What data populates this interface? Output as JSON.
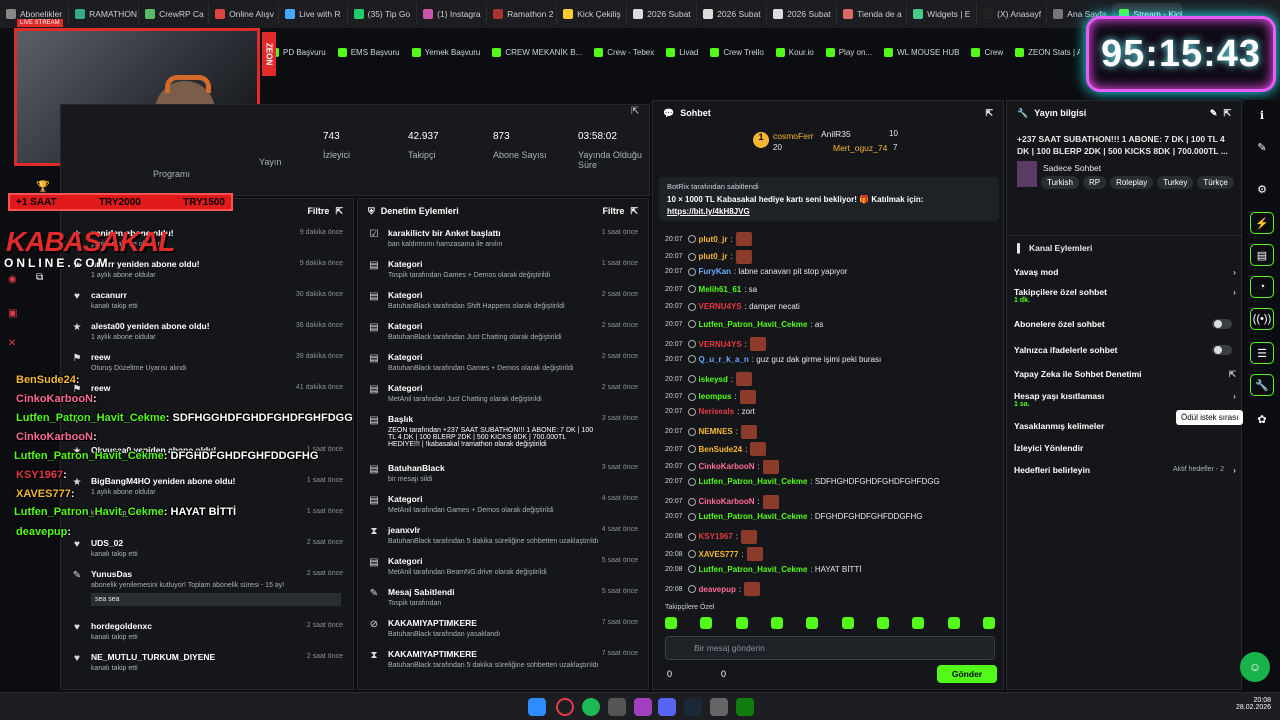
{
  "tabs": [
    "Abonelikler",
    "RAMATHON",
    "CrewRP Ca",
    "Online Alışv",
    "Live with R",
    "(35) Tip Go",
    "(1) Instagra",
    "Ramathon 2",
    "Kick Çekiliş",
    "2026 Subat",
    "2026 Subat",
    "2026 Subat",
    "Tienda de a",
    "Widgets | E",
    "(X) Anasayf",
    "Ana Sayfa",
    "Stream - Kick Dashb"
  ],
  "bookmarks": [
    "PD Başvuru",
    "EMS Başvuru",
    "Yemek Başvuru",
    "CREW MEKANİK B...",
    "Crew - Tebex",
    "Livad",
    "Crew Trello",
    "Kour.io",
    "Play on...",
    "WL MOUSE HUB",
    "Crew",
    "ZEON Stats | Aero...",
    "APIq"
  ],
  "timer": "95:15:43",
  "cam": {
    "zeon_label": "ZEON",
    "live_badge": "LIVE STREAM"
  },
  "overlay": {
    "plus_saat": "+1 SAAT",
    "try2000": "TRY2000",
    "try1500": "TRY1500",
    "brand": "KABASAKAL",
    "brand_sub": "ONLINE.COM"
  },
  "stats": {
    "left_label1": "Yayın",
    "left_label2": "Programı",
    "items": [
      {
        "value": "743",
        "label": "İzleyici"
      },
      {
        "value": "42.937",
        "label": "Takipçi"
      },
      {
        "value": "873",
        "label": "Abone Sayısı"
      },
      {
        "value": "03:58:02",
        "label": "Yayında Olduğu Süre"
      }
    ]
  },
  "events": {
    "filter": "Filtre",
    "items": [
      {
        "title": "yeniden abone oldu!",
        "sub": "yeniden abone oldular",
        "time": "9 dakika önce"
      },
      {
        "title": "nrrnrr yeniden abone oldu!",
        "sub": "1 aylık abone oldular",
        "time": "9 dakika önce"
      },
      {
        "title": "cacanurr",
        "sub": "kanalı takip etti",
        "time": "30 dakika önce"
      },
      {
        "title": "alesta00 yeniden abone oldu!",
        "sub": "1 aylık abone oldular",
        "time": "36 dakika önce"
      },
      {
        "title": "reew",
        "sub": "Oturuş Düzeltme Uyarısı alındı",
        "time": "39 dakika önce"
      },
      {
        "title": "reew",
        "sub": "",
        "time": "41 dakika önce"
      },
      {
        "title": "",
        "sub": "",
        "time": "1 saat önce"
      },
      {
        "title": "Okyusea0 yeniden abone oldu!",
        "sub": "",
        "time": "1 saat önce"
      },
      {
        "title": "BigBangM4HO yeniden abone oldu!",
        "sub": "1 aylık abone oldular",
        "time": "1 saat önce"
      },
      {
        "title": "",
        "sub": "kanalı takip etti",
        "time": "1 saat önce"
      },
      {
        "title": "UDS_02",
        "sub": "kanalı takip etti",
        "time": "2 saat önce"
      },
      {
        "title": "YunusDas",
        "sub": "abonelik yenilemesini kutluyor! Toplam abonelik süresi - 15 ay!",
        "time": "2 saat önce"
      },
      {
        "title": "hordegoldenxc",
        "sub": "kanalı takip etti",
        "time": "2 saat önce"
      },
      {
        "title": "NE_MUTLU_TURKUM_DIYENE",
        "sub": "kanalı takip etti",
        "time": "2 saat önce"
      }
    ],
    "quote": "sea sea"
  },
  "mod": {
    "title": "Denetim Eylemleri",
    "filter": "Filtre",
    "items": [
      {
        "title": "karakilictv bir Anket başlattı",
        "sub": "ban kaldırmımı hamzasama ile anılın",
        "time": "1 saat önce"
      },
      {
        "title": "Kategori",
        "sub": "Tospik tarafından Games + Demos olarak değiştirildi",
        "time": "1 saat önce"
      },
      {
        "title": "Kategori",
        "sub": "BatuhanBlack tarafından Shift Happens olarak değiştirildi",
        "time": "2 saat önce"
      },
      {
        "title": "Kategori",
        "sub": "BatuhanBlack tarafından Just Chatting olarak değiştirildi",
        "time": "2 saat önce"
      },
      {
        "title": "Kategori",
        "sub": "BatuhanBlack tarafından Games + Demos olarak değiştirildi",
        "time": "2 saat önce"
      },
      {
        "title": "Kategori",
        "sub": "MetAnil tarafından Just Chatting olarak değiştirildi",
        "time": "2 saat önce"
      },
      {
        "title": "Başlık",
        "sub": "ZEON tarafından +237 SAAT SUBATHON!!! 1 ABONE: 7 DK | 100 TL 4 DK | 100 BLERP 2DK | 500 KICKS 8DK | 700.000TL HEDİYE!!! | !kabasakal !ramathon olarak değiştirildi",
        "time": "3 saat önce"
      },
      {
        "title": "BatuhanBlack",
        "sub": "bir mesajı sildi",
        "time": "3 saat önce"
      },
      {
        "title": "Kategori",
        "sub": "MetAnil tarafından Games + Demos olarak değiştirildi",
        "time": "4 saat önce"
      },
      {
        "title": "jeanxvlr",
        "sub": "BatuhanBlack tarafından 5 dakika süreliğine sohbetten uzaklaştırıldı",
        "time": "4 saat önce"
      },
      {
        "title": "Kategori",
        "sub": "MetAnil tarafından BeamNG.drive olarak değiştirildi",
        "time": "5 saat önce"
      },
      {
        "title": "Mesaj Sabitlendi",
        "sub": "Tospik tarafından",
        "time": "5 saat önce"
      },
      {
        "title": "KAKAMIYAPTIMKERE",
        "sub": "BatuhanBlack tarafından yasaklandı",
        "time": "7 saat önce"
      },
      {
        "title": "KAKAMIYAPTIMKERE",
        "sub": "BatuhanBlack tarafından 5 dakika süreliğine sohbetten uzaklaştırıldı",
        "time": "7 saat önce"
      }
    ]
  },
  "chat": {
    "title": "Sohbet",
    "top_gifter": {
      "name": "cosmoFerr",
      "count": "20"
    },
    "gifter2": {
      "name": "AnilR35",
      "count": "10"
    },
    "gifter3": {
      "name": "Mert_oguz_74",
      "count": "7"
    },
    "pinned_by": "BotRix tarafından sabitlendi",
    "pinned_text": "10 × 1000 TL Kabasakal hediye kartı seni bekliyor! 🎁 Katılmak için:",
    "pinned_link": "https://bit.ly/4kH8JVG",
    "messages": [
      {
        "time": "20:07",
        "user": "plut0_jr",
        "color": "#f7b733",
        "text": ":"
      },
      {
        "time": "20:07",
        "user": "plut0_jr",
        "color": "#f7b733",
        "text": ":"
      },
      {
        "time": "20:07",
        "user": "FuryKan",
        "color": "#6aa9ff",
        "text": ": labne canavarı pit stop yapıyor"
      },
      {
        "time": "20:07",
        "user": "Melih61_61",
        "color": "#53fc18",
        "text": ": sa"
      },
      {
        "time": "20:07",
        "user": "VERNU4YS",
        "color": "#e63946",
        "text": ": damper necati"
      },
      {
        "time": "20:07",
        "user": "Lutfen_Patron_Havit_Cekme",
        "color": "#53fc18",
        "text": ": as"
      },
      {
        "time": "20:07",
        "user": "VERNU4YS",
        "color": "#e63946",
        "text": ":"
      },
      {
        "time": "20:07",
        "user": "Q_u_r_k_a_n",
        "color": "#6aa9ff",
        "text": ": guz guz dak girme işimi peki burası"
      },
      {
        "time": "20:07",
        "user": "iskeysd",
        "color": "#53fc18",
        "text": ":"
      },
      {
        "time": "20:07",
        "user": "leompus",
        "color": "#53fc18",
        "text": ":"
      },
      {
        "time": "20:07",
        "user": "Neriseals",
        "color": "#e63946",
        "text": ": zort"
      },
      {
        "time": "20:07",
        "user": "NEMNES",
        "color": "#f7b733",
        "text": ":"
      },
      {
        "time": "20:07",
        "user": "BenSude24",
        "color": "#f7b733",
        "text": ":"
      },
      {
        "time": "20:07",
        "user": "CinkoKarbooN",
        "color": "#ff6b9a",
        "text": ":"
      },
      {
        "time": "20:07",
        "user": "Lutfen_Patron_Havit_Cekme",
        "color": "#53fc18",
        "text": ": SDFHGHDFGHDFGHDFGHFDGG"
      },
      {
        "time": "20:07",
        "user": "CinkoKarbooN",
        "color": "#ff6b9a",
        "text": ":"
      },
      {
        "time": "20:07",
        "user": "Lutfen_Patron_Havit_Cekme",
        "color": "#53fc18",
        "text": ": DFGHDFGHDFGHFDDGFHG"
      },
      {
        "time": "20:08",
        "user": "KSY1967",
        "color": "#e63946",
        "text": ":"
      },
      {
        "time": "20:08",
        "user": "XAVES777",
        "color": "#f7b733",
        "text": ":"
      },
      {
        "time": "20:08",
        "user": "Lutfen_Patron_Havit_Cekme",
        "color": "#53fc18",
        "text": ": HAYAT BİTTİ"
      },
      {
        "time": "20:08",
        "user": "deavepup",
        "color": "#ff6b9a",
        "text": ":"
      }
    ],
    "followers_only": "Takipçilere Özel",
    "input_placeholder": "Bir mesaj gönderin",
    "count_a": "0",
    "count_b": "0",
    "send_label": "Gönder"
  },
  "info": {
    "title": "Yayın bilgisi",
    "stream_title": "+237 SAAT SUBATHON!!! 1 ABONE: 7 DK | 100 TL 4 DK | 100 BLERP 2DK | 500 KICKS 8DK | 700.000TL ...",
    "category": "Sadece Sohbet",
    "tags": [
      "Turkish",
      "RP",
      "Roleplay",
      "Turkey",
      "Türkçe"
    ]
  },
  "channel_actions": {
    "title": "Kanal Eylemleri",
    "items": [
      {
        "label": "Yavaş mod",
        "sub": ""
      },
      {
        "label": "Takipçilere özel sohbet",
        "sub": "1 dk."
      },
      {
        "label": "Abonelere özel sohbet",
        "sub": ""
      },
      {
        "label": "Yalnızca ifadelerle sohbet",
        "sub": ""
      },
      {
        "label": "Yapay Zeka ile Sohbet Denetimi",
        "sub": ""
      },
      {
        "label": "Hesap yaşı kısıtlaması",
        "sub": "1 sa."
      },
      {
        "label": "Yasaklanmış kelimeler",
        "sub": ""
      },
      {
        "label": "İzleyici Yönlendir",
        "sub": ""
      },
      {
        "label": "Hedefleri belirleyin",
        "sub": ""
      }
    ],
    "goals_active": "Aktif hedefler - 2",
    "tooltip": "Ödül istek sırası"
  },
  "overlay_chat": [
    {
      "user": "BenSude24",
      "color": "#f7b733",
      "text": ":"
    },
    {
      "user": "CinkoKarbooN",
      "color": "#ff6b9a",
      "text": ":"
    },
    {
      "user": "Lutfen_Patron_Havit_Cekme",
      "color": "#53fc18",
      "text": ": SDFHGGHDFGHDFGHDFGHFDGG"
    },
    {
      "user": "CinkoKarbooN",
      "color": "#ff6b9a",
      "text": ":"
    },
    {
      "user": "Lutfen_Patron_Havit_Cekme",
      "color": "#53fc18",
      "text": ": DFGHDFGHDFGHFDDGFHG"
    },
    {
      "user": "KSY1967",
      "color": "#e63946",
      "text": ":"
    },
    {
      "user": "XAVES777",
      "color": "#f7b733",
      "text": ":"
    },
    {
      "user": "Lutfen_Patron_Havit_Cekme",
      "color": "#53fc18",
      "text": ": HAYAT BİTTİ"
    },
    {
      "user": "deavepup",
      "color": "#53fc18",
      "text": ":"
    }
  ],
  "clock": {
    "time": "20:08",
    "date": "28.02.2026"
  },
  "colors": {
    "accent": "#53fc18",
    "panel": "#141619",
    "timer_border": "#e85df5"
  }
}
